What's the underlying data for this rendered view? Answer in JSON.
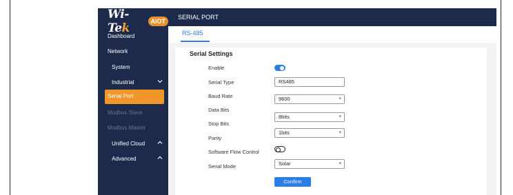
{
  "logo": {
    "text_main": "Wi-Te",
    "text_accent": "k",
    "badge": "AIOT"
  },
  "sidebar": {
    "items": [
      {
        "label": "Dashboard"
      },
      {
        "label": "Network"
      },
      {
        "label": "System"
      },
      {
        "label": "Industrial",
        "chevron": "chevron-down"
      },
      {
        "label": "Serial Port",
        "active": true
      },
      {
        "label": "Modbus Slave"
      },
      {
        "label": "Modbus Master"
      },
      {
        "label": "Unified Cloud",
        "chevron": "chevron-up"
      },
      {
        "label": "Advanced",
        "chevron": "chevron-up"
      }
    ]
  },
  "header": {
    "title": "SERIAL PORT"
  },
  "tabs": [
    {
      "label": "RS-485",
      "active": true
    }
  ],
  "section": {
    "title": "Serial Settings"
  },
  "form": {
    "enable": {
      "label": "Enable",
      "checked": true
    },
    "serial_type": {
      "label": "Serial Type",
      "value": "RS485"
    },
    "baud_rate": {
      "label": "Baud Rate",
      "value": "9600"
    },
    "data_bits": {
      "label": "Data Bits",
      "value": "8bits"
    },
    "stop_bits": {
      "label": "Stop Bits"
    },
    "parity": {
      "label": "Parity",
      "value": "1bits"
    },
    "software_flow_control": {
      "label": "Software Flow Control",
      "checked": false
    },
    "serial_mode": {
      "label": "Serial Mode",
      "value": "Solar"
    },
    "confirm_label": "Confirm"
  },
  "colors": {
    "sidebar_bg": "#1e2a4c",
    "accent": "#2b7ee8",
    "active_item": "#f0962a"
  }
}
